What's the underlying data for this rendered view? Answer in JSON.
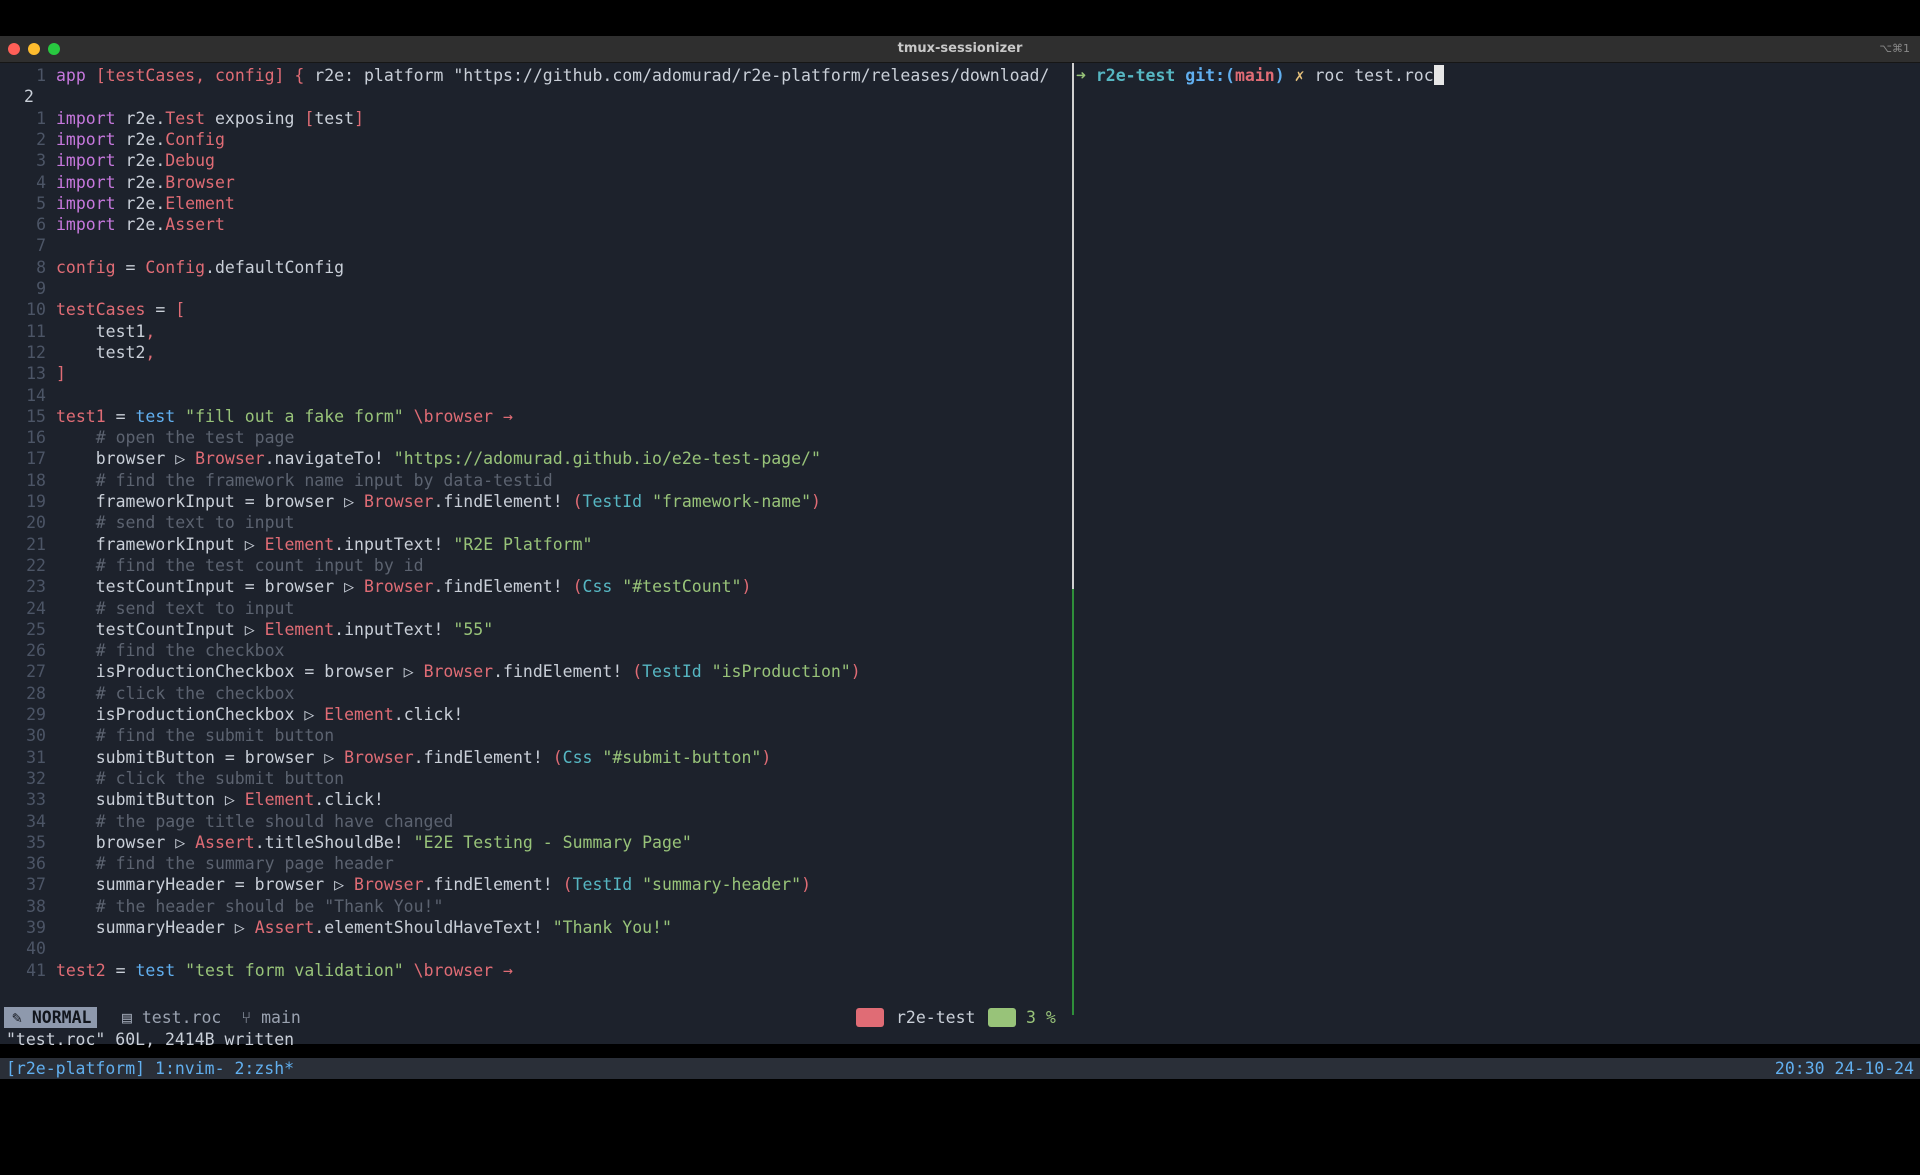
{
  "window": {
    "title": "tmux-sessionizer",
    "shortcut": "⌥⌘1",
    "colors": {
      "close": "#ff5f57",
      "minimize": "#febc2e",
      "maximize": "#28c840"
    }
  },
  "editor": {
    "lines": [
      {
        "n": "1",
        "s": [
          [
            "app ",
            "kw"
          ],
          [
            "[testCases, config] { ",
            "red"
          ],
          [
            "r2e: platform ",
            ""
          ],
          [
            "\"https://github.com/adomurad/r2e-platform/releases/download/",
            ""
          ]
        ]
      },
      {
        "n": "2",
        "cur": true,
        "s": []
      },
      {
        "n": "1",
        "s": [
          [
            "import ",
            "kw"
          ],
          [
            "r2e.",
            ""
          ],
          [
            "Test ",
            "red"
          ],
          [
            "exposing ",
            ""
          ],
          [
            "[",
            "red"
          ],
          [
            "test",
            ""
          ],
          [
            "]",
            "red"
          ]
        ]
      },
      {
        "n": "2",
        "s": [
          [
            "import ",
            "kw"
          ],
          [
            "r2e.",
            ""
          ],
          [
            "Config",
            "red"
          ]
        ]
      },
      {
        "n": "3",
        "s": [
          [
            "import ",
            "kw"
          ],
          [
            "r2e.",
            ""
          ],
          [
            "Debug",
            "red"
          ]
        ]
      },
      {
        "n": "4",
        "s": [
          [
            "import ",
            "kw"
          ],
          [
            "r2e.",
            ""
          ],
          [
            "Browser",
            "red"
          ]
        ]
      },
      {
        "n": "5",
        "s": [
          [
            "import ",
            "kw"
          ],
          [
            "r2e.",
            ""
          ],
          [
            "Element",
            "red"
          ]
        ]
      },
      {
        "n": "6",
        "s": [
          [
            "import ",
            "kw"
          ],
          [
            "r2e.",
            ""
          ],
          [
            "Assert",
            "red"
          ]
        ]
      },
      {
        "n": "7",
        "s": []
      },
      {
        "n": "8",
        "s": [
          [
            "config",
            "red"
          ],
          [
            " = ",
            ""
          ],
          [
            "Config",
            "red"
          ],
          [
            ".defaultConfig",
            ""
          ]
        ]
      },
      {
        "n": "9",
        "s": []
      },
      {
        "n": "10",
        "s": [
          [
            "testCases",
            "red"
          ],
          [
            " = ",
            ""
          ],
          [
            "[",
            "red"
          ]
        ]
      },
      {
        "n": "11",
        "s": [
          [
            "    test1",
            ""
          ],
          [
            ",",
            "red"
          ]
        ]
      },
      {
        "n": "12",
        "s": [
          [
            "    test2",
            ""
          ],
          [
            ",",
            "red"
          ]
        ]
      },
      {
        "n": "13",
        "s": [
          [
            "]",
            "red"
          ]
        ]
      },
      {
        "n": "14",
        "s": []
      },
      {
        "n": "15",
        "s": [
          [
            "test1",
            "red"
          ],
          [
            " = ",
            ""
          ],
          [
            "test ",
            "blue"
          ],
          [
            "\"fill out a fake form\" ",
            "str"
          ],
          [
            "\\browser →",
            "red"
          ]
        ]
      },
      {
        "n": "16",
        "s": [
          [
            "    # open the test page",
            "cmt"
          ]
        ]
      },
      {
        "n": "17",
        "s": [
          [
            "    browser ▷ ",
            ""
          ],
          [
            "Browser",
            "red"
          ],
          [
            ".navigateTo! ",
            ""
          ],
          [
            "\"https://adomurad.github.io/e2e-test-page/\"",
            "str"
          ]
        ]
      },
      {
        "n": "18",
        "s": [
          [
            "    # find the framework name input by data-testid",
            "cmt"
          ]
        ]
      },
      {
        "n": "19",
        "s": [
          [
            "    frameworkInput = browser ▷ ",
            ""
          ],
          [
            "Browser",
            "red"
          ],
          [
            ".findElement! ",
            ""
          ],
          [
            "(",
            "red"
          ],
          [
            "TestId ",
            "cyan"
          ],
          [
            "\"framework-name\"",
            "str"
          ],
          [
            ")",
            "red"
          ]
        ]
      },
      {
        "n": "20",
        "s": [
          [
            "    # send text to input",
            "cmt"
          ]
        ]
      },
      {
        "n": "21",
        "s": [
          [
            "    frameworkInput ▷ ",
            ""
          ],
          [
            "Element",
            "red"
          ],
          [
            ".inputText! ",
            ""
          ],
          [
            "\"R2E Platform\"",
            "str"
          ]
        ]
      },
      {
        "n": "22",
        "s": [
          [
            "    # find the test count input by id",
            "cmt"
          ]
        ]
      },
      {
        "n": "23",
        "s": [
          [
            "    testCountInput = browser ▷ ",
            ""
          ],
          [
            "Browser",
            "red"
          ],
          [
            ".findElement! ",
            ""
          ],
          [
            "(",
            "red"
          ],
          [
            "Css ",
            "cyan"
          ],
          [
            "\"#testCount\"",
            "str"
          ],
          [
            ")",
            "red"
          ]
        ]
      },
      {
        "n": "24",
        "s": [
          [
            "    # send text to input",
            "cmt"
          ]
        ]
      },
      {
        "n": "25",
        "s": [
          [
            "    testCountInput ▷ ",
            ""
          ],
          [
            "Element",
            "red"
          ],
          [
            ".inputText! ",
            ""
          ],
          [
            "\"55\"",
            "str"
          ]
        ]
      },
      {
        "n": "26",
        "s": [
          [
            "    # find the checkbox",
            "cmt"
          ]
        ]
      },
      {
        "n": "27",
        "s": [
          [
            "    isProductionCheckbox = browser ▷ ",
            ""
          ],
          [
            "Browser",
            "red"
          ],
          [
            ".findElement! ",
            ""
          ],
          [
            "(",
            "red"
          ],
          [
            "TestId ",
            "cyan"
          ],
          [
            "\"isProduction\"",
            "str"
          ],
          [
            ")",
            "red"
          ]
        ]
      },
      {
        "n": "28",
        "s": [
          [
            "    # click the checkbox",
            "cmt"
          ]
        ]
      },
      {
        "n": "29",
        "s": [
          [
            "    isProductionCheckbox ▷ ",
            ""
          ],
          [
            "Element",
            "red"
          ],
          [
            ".click!",
            ""
          ]
        ]
      },
      {
        "n": "30",
        "s": [
          [
            "    # find the submit button",
            "cmt"
          ]
        ]
      },
      {
        "n": "31",
        "s": [
          [
            "    submitButton = browser ▷ ",
            ""
          ],
          [
            "Browser",
            "red"
          ],
          [
            ".findElement! ",
            ""
          ],
          [
            "(",
            "red"
          ],
          [
            "Css ",
            "cyan"
          ],
          [
            "\"#submit-button\"",
            "str"
          ],
          [
            ")",
            "red"
          ]
        ]
      },
      {
        "n": "32",
        "s": [
          [
            "    # click the submit button",
            "cmt"
          ]
        ]
      },
      {
        "n": "33",
        "s": [
          [
            "    submitButton ▷ ",
            ""
          ],
          [
            "Element",
            "red"
          ],
          [
            ".click!",
            ""
          ]
        ]
      },
      {
        "n": "34",
        "s": [
          [
            "    # the page title should have changed",
            "cmt"
          ]
        ]
      },
      {
        "n": "35",
        "s": [
          [
            "    browser ▷ ",
            ""
          ],
          [
            "Assert",
            "red"
          ],
          [
            ".titleShouldBe! ",
            ""
          ],
          [
            "\"E2E Testing - Summary Page\"",
            "str"
          ]
        ]
      },
      {
        "n": "36",
        "s": [
          [
            "    # find the summary page header",
            "cmt"
          ]
        ]
      },
      {
        "n": "37",
        "s": [
          [
            "    summaryHeader = browser ▷ ",
            ""
          ],
          [
            "Browser",
            "red"
          ],
          [
            ".findElement! ",
            ""
          ],
          [
            "(",
            "red"
          ],
          [
            "TestId ",
            "cyan"
          ],
          [
            "\"summary-header\"",
            "str"
          ],
          [
            ")",
            "red"
          ]
        ]
      },
      {
        "n": "38",
        "s": [
          [
            "    # the header should be \"Thank You!\"",
            "cmt"
          ]
        ]
      },
      {
        "n": "39",
        "s": [
          [
            "    summaryHeader ▷ ",
            ""
          ],
          [
            "Assert",
            "red"
          ],
          [
            ".elementShouldHaveText! ",
            ""
          ],
          [
            "\"Thank You!\"",
            "str"
          ]
        ]
      },
      {
        "n": "40",
        "s": []
      },
      {
        "n": "41",
        "s": [
          [
            "test2",
            "red"
          ],
          [
            " = ",
            ""
          ],
          [
            "test ",
            "blue"
          ],
          [
            "\"test form validation\" ",
            "str"
          ],
          [
            "\\browser →",
            "red"
          ]
        ]
      }
    ]
  },
  "statusline": {
    "mode": "NORMAL",
    "file": "test.roc",
    "branch": "main",
    "session": "r2e-test",
    "percent": "3 %"
  },
  "message": "\"test.roc\" 60L, 2414B written",
  "terminal": {
    "arrow": "➜",
    "dir": "r2e-test",
    "git_prefix": "git:(",
    "git_branch": "main",
    "git_suffix": ")",
    "dirty": "✗",
    "command": "roc test.roc"
  },
  "tmux": {
    "left": "[r2e-platform] 1:nvim- 2:zsh*",
    "right": "20:30 24-10-24"
  }
}
